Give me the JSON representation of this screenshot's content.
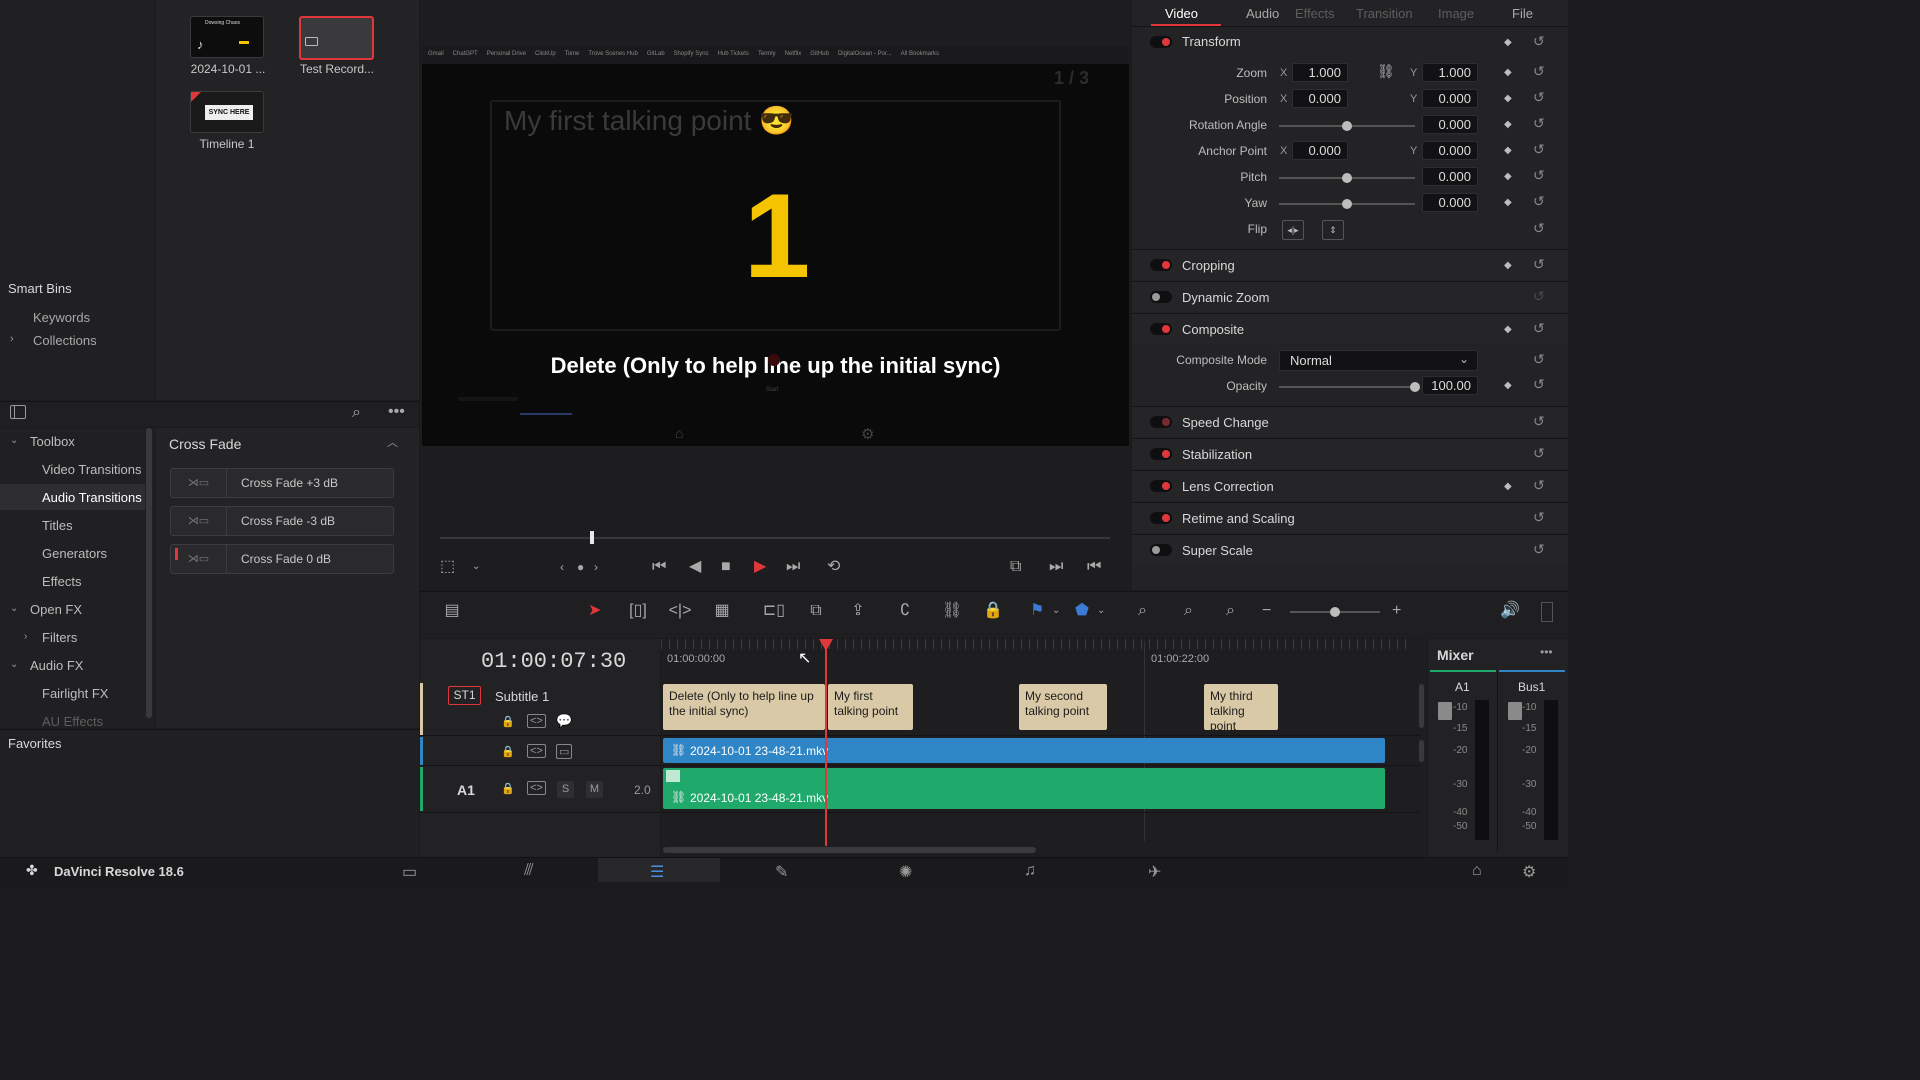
{
  "media_pool": {
    "clips": [
      {
        "name": "2024-10-01 ...",
        "thumb_text": "Dowsing Chaos"
      },
      {
        "name": "Test Record...",
        "thumb_text": ""
      },
      {
        "name": "Timeline 1",
        "thumb_text": "SYNC HERE"
      }
    ]
  },
  "bins": {
    "smart_bins_label": "Smart Bins",
    "items": [
      "Keywords",
      "Collections"
    ],
    "favorites_label": "Favorites"
  },
  "toolbox": {
    "items": [
      {
        "label": "Toolbox",
        "level": 0,
        "caret": "v"
      },
      {
        "label": "Video Transitions",
        "level": 1
      },
      {
        "label": "Audio Transitions",
        "level": 1,
        "selected": true
      },
      {
        "label": "Titles",
        "level": 1
      },
      {
        "label": "Generators",
        "level": 1
      },
      {
        "label": "Effects",
        "level": 1
      },
      {
        "label": "Open FX",
        "level": 0,
        "caret": "v"
      },
      {
        "label": "Filters",
        "level": 1,
        "caret": ">"
      },
      {
        "label": "Audio FX",
        "level": 0,
        "caret": "v"
      },
      {
        "label": "Fairlight FX",
        "level": 1
      },
      {
        "label": "AU Effects",
        "level": 1
      }
    ]
  },
  "transitions": {
    "group_title": "Cross Fade",
    "items": [
      "Cross Fade +3 dB",
      "Cross Fade -3 dB",
      "Cross Fade 0 dB"
    ]
  },
  "viewer": {
    "bookmarks": [
      "Gmail",
      "ChatGPT",
      "Personal Drive",
      "ClickUp",
      "Tome",
      "Trove Scenes Hub",
      "GitLab",
      "Shopify Sync",
      "Hub Tickets",
      "Termly",
      "Netflix",
      "GitHub",
      "DigitalOcean - Por...",
      "All Bookmarks"
    ],
    "page_counter": "1 / 3",
    "title_text": "My first talking point 😎",
    "countdown": "1",
    "subtitle": "Delete (Only to help line up the initial sync)",
    "start_label": "Start",
    "progress": 0.26
  },
  "inspector": {
    "tabs": [
      {
        "label": "Video",
        "active": true
      },
      {
        "label": "Audio",
        "active": false
      },
      {
        "label": "Effects",
        "active": false
      },
      {
        "label": "Transition",
        "active": false
      },
      {
        "label": "Image",
        "active": false
      },
      {
        "label": "File",
        "active": false
      }
    ],
    "transform_title": "Transform",
    "zoom": {
      "label": "Zoom",
      "x": "1.000",
      "y": "1.000"
    },
    "position": {
      "label": "Position",
      "x": "0.000",
      "y": "0.000"
    },
    "rotation": {
      "label": "Rotation Angle",
      "value": "0.000"
    },
    "anchor": {
      "label": "Anchor Point",
      "x": "0.000",
      "y": "0.000"
    },
    "pitch": {
      "label": "Pitch",
      "value": "0.000"
    },
    "yaw": {
      "label": "Yaw",
      "value": "0.000"
    },
    "flip_label": "Flip",
    "x_label": "X",
    "y_label": "Y",
    "sections": [
      {
        "title": "Cropping",
        "enabled": true
      },
      {
        "title": "Dynamic Zoom",
        "enabled": false
      },
      {
        "title": "Composite",
        "enabled": true
      }
    ],
    "composite_mode": {
      "label": "Composite Mode",
      "value": "Normal"
    },
    "opacity": {
      "label": "Opacity",
      "value": "100.00",
      "level": 1.0
    },
    "sections2": [
      {
        "title": "Speed Change",
        "enabled": true
      },
      {
        "title": "Stabilization",
        "enabled": true
      },
      {
        "title": "Lens Correction",
        "enabled": true
      },
      {
        "title": "Retime and Scaling",
        "enabled": true
      },
      {
        "title": "Super Scale",
        "enabled": false
      }
    ]
  },
  "timeline": {
    "timecode": "01:00:07:30",
    "ruler": [
      "01:00:00:00",
      "01:00:22:00"
    ],
    "tracks": {
      "subtitle": {
        "id": "ST1",
        "name": "Subtitle 1"
      },
      "audio": {
        "id": "A1",
        "s": "S",
        "m": "M",
        "level": "2.0"
      }
    },
    "subtitle_clips": [
      "Delete (Only to help line up the initial sync)",
      "My first talking point",
      "My second talking point",
      "My third talking point"
    ],
    "video_clip": "2024-10-01 23-48-21.mkv",
    "audio_clip": "2024-10-01 23-48-21.mkv"
  },
  "mixer": {
    "title": "Mixer",
    "channels": [
      "A1",
      "Bus1"
    ],
    "scale": [
      "-10",
      "-15",
      "-20",
      "-30",
      "-40",
      "-50"
    ]
  },
  "app": {
    "name": "DaVinci Resolve 18.6"
  },
  "colors": {
    "accent_red": "#e0373a",
    "subtitle_clip": "#d9c9a6",
    "video_clip": "#2f86c6",
    "audio_clip": "#1faa6c"
  }
}
